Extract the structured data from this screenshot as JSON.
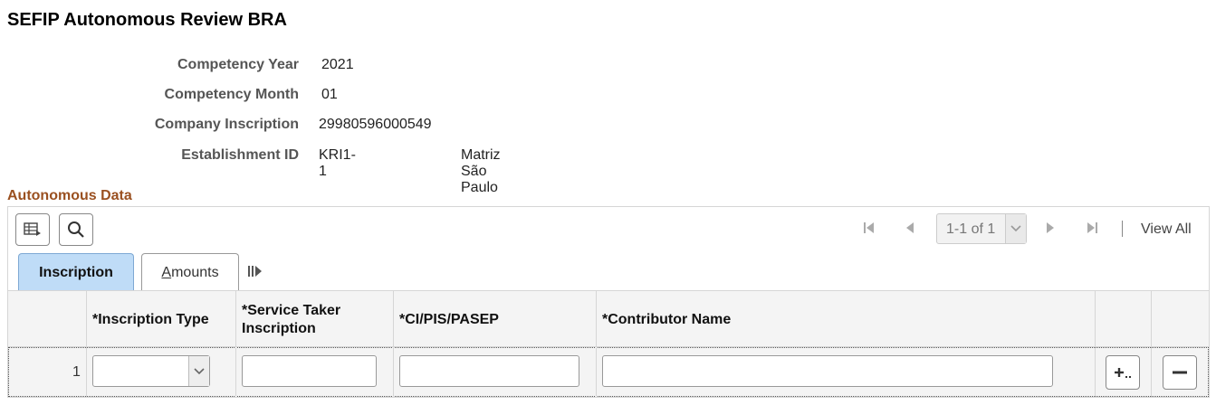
{
  "page": {
    "title": "SEFIP Autonomous Review BRA"
  },
  "fields": {
    "competency_year": {
      "label": "Competency Year",
      "value": "2021"
    },
    "competency_month": {
      "label": "Competency Month",
      "value": "01"
    },
    "company_inscription": {
      "label": "Company Inscription",
      "value": "29980596000549"
    },
    "establishment_id": {
      "label": "Establishment ID",
      "value": "KRI1-1",
      "description": "Matriz São Paulo"
    }
  },
  "grid": {
    "title": "Autonomous Data",
    "toolbar": {
      "personalize_icon": "grid-settings-icon",
      "find_icon": "search-icon"
    },
    "pager": {
      "range": "1-1 of 1",
      "view_all": "View All"
    },
    "tabs": [
      {
        "label": "Inscription",
        "active": true
      },
      {
        "label_pre": "",
        "label_u": "A",
        "label_post": "mounts",
        "active": false
      }
    ],
    "columns": {
      "inscription_type": "*Inscription Type",
      "service_taker": "*Service Taker Inscription",
      "ci_pis_pasep": "*CI/PIS/PASEP",
      "contributor_name": "*Contributor Name"
    },
    "rows": [
      {
        "number": "1",
        "inscription_type": "",
        "service_taker": "",
        "ci_pis_pasep": "",
        "contributor_name": ""
      }
    ]
  },
  "colors": {
    "section_title": "#9a5020",
    "active_tab": "#bfdcf7"
  }
}
